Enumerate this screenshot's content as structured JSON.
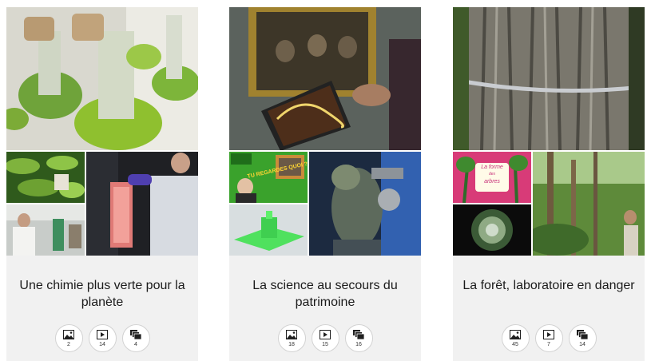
{
  "cards": [
    {
      "title": "Une chimie plus verte pour la planète",
      "stats": {
        "images": "2",
        "videos": "14",
        "collections": "4"
      }
    },
    {
      "title": "La science au secours du patrimoine",
      "stats": {
        "images": "18",
        "videos": "15",
        "collections": "16"
      }
    },
    {
      "title": "La forêt, laboratoire en danger",
      "stats": {
        "images": "45",
        "videos": "7",
        "collections": "14"
      }
    }
  ],
  "thumbnail_text": {
    "tu_regardes": "TU REGARDES QUOI ?",
    "la_forme": "La forme",
    "des": "des",
    "arbres": "arbres"
  },
  "icons": {
    "images": "image-icon",
    "videos": "video-play-icon",
    "collections": "collection-stack-icon"
  },
  "colors": {
    "card_background": "#f1f1f1",
    "title_text": "#1b1b1b"
  }
}
